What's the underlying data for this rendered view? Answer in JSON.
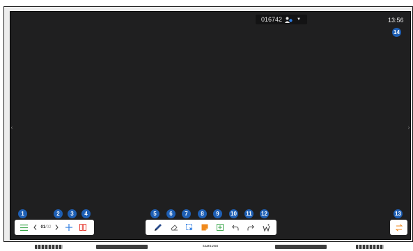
{
  "top": {
    "pin_code": "016742",
    "user_icon": "user-connect-icon",
    "dropdown_icon": "caret-down-icon",
    "clock": "13:56"
  },
  "callouts": [
    "1",
    "2",
    "3",
    "4",
    "5",
    "6",
    "7",
    "8",
    "9",
    "10",
    "11",
    "12",
    "13",
    "14"
  ],
  "left_toolbar": {
    "menu_icon": "hamburger-menu-icon",
    "prev_icon": "chevron-left-icon",
    "page_current": "01",
    "page_total": "/02",
    "next_icon": "chevron-right-icon",
    "add_icon": "plus-icon",
    "layout_icon": "page-overview-icon"
  },
  "center_toolbar": {
    "tools": [
      {
        "name": "pen-icon"
      },
      {
        "name": "eraser-icon"
      },
      {
        "name": "select-icon"
      },
      {
        "name": "sticky-note-icon"
      },
      {
        "name": "insert-icon"
      },
      {
        "name": "undo-icon"
      },
      {
        "name": "redo-icon"
      },
      {
        "name": "smart-tool-icon"
      }
    ]
  },
  "right_toolbar": {
    "toggle_icon": "swap-arrows-icon"
  },
  "base": {
    "brand": "SAMSUNG"
  },
  "colors": {
    "screen": "#1f1f20",
    "callout": "#1e5fb4",
    "accent_red": "#e8453c",
    "accent_orange": "#f08a1c",
    "accent_green": "#3aa64b",
    "pen_blue": "#2a4c8c"
  }
}
